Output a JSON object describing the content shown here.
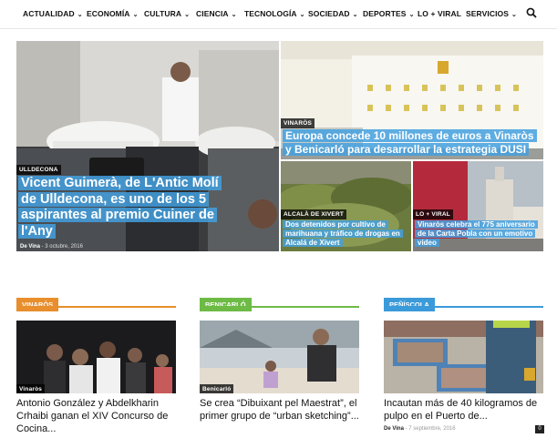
{
  "nav": {
    "items": [
      "ACTUALIDAD",
      "ECONOMÍA",
      "CULTURA",
      "CIENCIA",
      "TECNOLOGÍA",
      "SOCIEDAD",
      "DEPORTES",
      "LO + VIRAL",
      "SERVICIOS"
    ],
    "search_icon": "search-icon"
  },
  "featured": {
    "main": {
      "category": "ULLDECONA",
      "title": "Vicent Guimerà, de L'Antic Molí de Ulldecona, es uno de los 5 aspirantes al premio Cuiner de l'Any",
      "author": "De Vina",
      "date": "- 3 octubre, 2016"
    },
    "top_right": {
      "category": "VINARÒS",
      "title": "Europa concede 10 millones de euros a Vinaròs y Benicarló para desarrollar la estrategia DUSI"
    },
    "bottom_left": {
      "category": "ALCALÀ DE XIVERT",
      "title": "Dos detenidos por cultivo de marihuana y tráfico de drogas en Alcalá de Xivert"
    },
    "bottom_right": {
      "category": "LO + VIRAL",
      "title": "Vinaròs celebra el 775 aniversario de la Carta Pobla con un emotivo video"
    }
  },
  "sections": [
    {
      "label": "VINARÒS",
      "color": "#e88e2c",
      "card_category": "Vinaròs",
      "title": "Antonio González y Abdelkharin Crhaibi ganan el XIV Concurso de Cocina..."
    },
    {
      "label": "BENICARLÓ",
      "color": "#6dbb45",
      "card_category": "Benicarló",
      "title": "Se crea “Dibuixant pel Maestrat”, el primer grupo de “urban sketching”..."
    },
    {
      "label": "PEÑÍSCOLA",
      "color": "#3b9ad9",
      "card_category": "",
      "title": "Incautan más de 40 kilogramos de pulpo en el Puerto de...",
      "author": "De Vina",
      "date": "- 7 septiembre, 2016",
      "comments": "0"
    }
  ],
  "colors": {
    "accent": "#43a0df"
  }
}
